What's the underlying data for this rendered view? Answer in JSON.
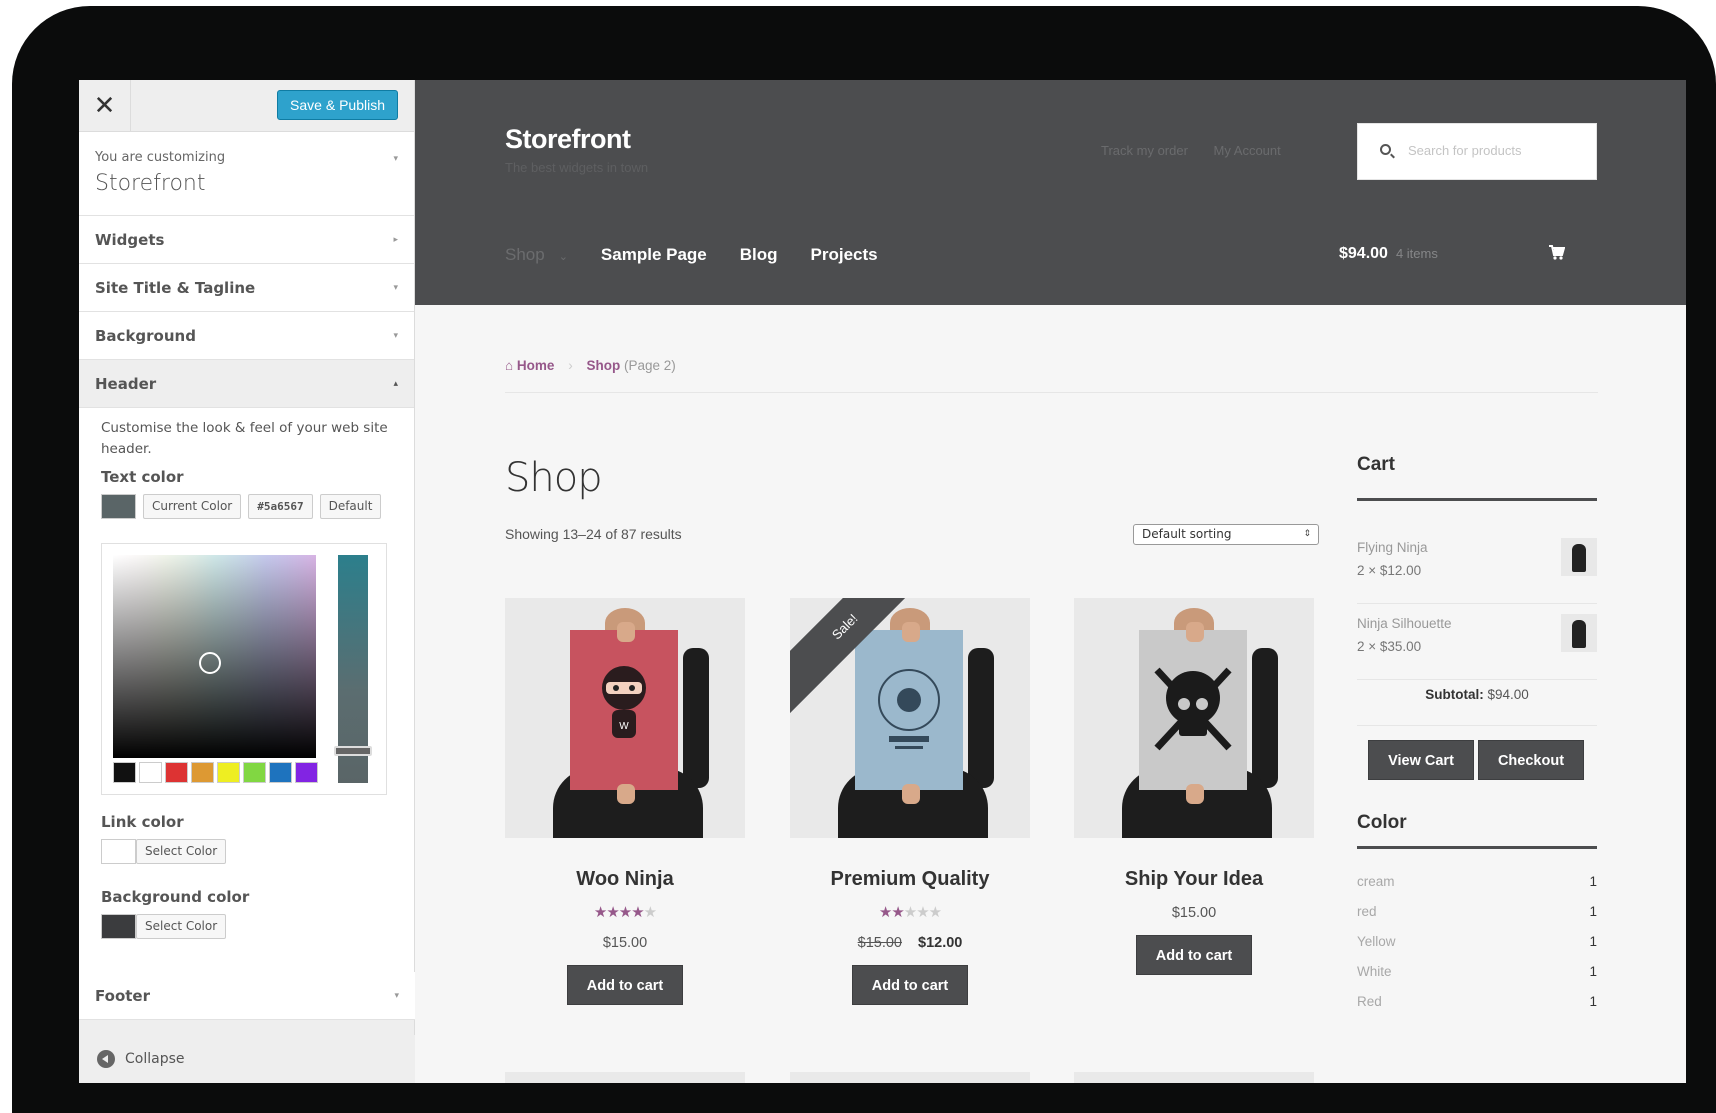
{
  "customizer": {
    "close_glyph": "✕",
    "save_label": "Save & Publish",
    "info_small": "You are customizing",
    "info_big": "Storefront",
    "sections": [
      {
        "label": "Widgets",
        "caret": "▸"
      },
      {
        "label": "Site Title & Tagline",
        "caret": "▾"
      },
      {
        "label": "Background",
        "caret": "▾"
      },
      {
        "label": "Header",
        "caret": "▴"
      }
    ],
    "header_panel": {
      "description": "Customise the look & feel of your web site header.",
      "text_color": {
        "label": "Text color",
        "current_label": "Current Color",
        "hex_value": "#5a6567",
        "default_label": "Default",
        "swatch": "#5a6567"
      },
      "palette": [
        "#111111",
        "#ffffff",
        "#dd3333",
        "#dd9933",
        "#eeee22",
        "#81d742",
        "#1e73be",
        "#8224e3"
      ],
      "link_color": {
        "label": "Link color",
        "button": "Select Color",
        "swatch": "#ffffff"
      },
      "background_color": {
        "label": "Background color",
        "button": "Select Color",
        "swatch": "#3b3c3e"
      }
    },
    "footer": {
      "label": "Footer",
      "caret": "▾"
    },
    "collapse_label": "Collapse"
  },
  "site": {
    "logo": "Storefront",
    "tagline": "The best widgets in town",
    "top_links": [
      "Track my order",
      "My Account"
    ],
    "search_placeholder": "Search for products",
    "nav": {
      "shop": "Shop",
      "shop_chevron": "⌄",
      "items": [
        "Sample Page",
        "Blog",
        "Projects"
      ]
    },
    "minicart": {
      "total": "$94.00",
      "count": "4 items"
    },
    "breadcrumb": {
      "home": "Home",
      "separator": "›",
      "shop": "Shop",
      "page": "(Page 2)"
    },
    "page_title": "Shop",
    "results_text": "Showing 13–24 of 87 results",
    "sorting": {
      "selected": "Default sorting",
      "arrow": "⇕"
    },
    "products": [
      {
        "name": "Woo Ninja",
        "rating": 4,
        "rating_stars": "★★★★",
        "rating_empty": "★",
        "price": "$15.00",
        "button": "Add to cart",
        "poster_color": "#c7535f"
      },
      {
        "name": "Premium Quality",
        "rating": 2,
        "rating_stars": "★★",
        "rating_empty": "★★★",
        "price_old": "$15.00",
        "price_new": "$12.00",
        "sale_badge": "Sale!",
        "button": "Add to cart",
        "poster_color": "#9bb8cc"
      },
      {
        "name": "Ship Your Idea",
        "price": "$15.00",
        "button": "Add to cart",
        "poster_color": "#c9c9c9"
      }
    ],
    "cart_widget": {
      "title": "Cart",
      "items": [
        {
          "name": "Flying Ninja",
          "qty": "2 × $12.00"
        },
        {
          "name": "Ninja Silhouette",
          "qty": "2 × $35.00"
        }
      ],
      "subtotal_label": "Subtotal:",
      "subtotal_value": "$94.00",
      "view_cart": "View Cart",
      "checkout": "Checkout"
    },
    "color_widget": {
      "title": "Color",
      "rows": [
        {
          "name": "cream",
          "count": "1"
        },
        {
          "name": "red",
          "count": "1"
        },
        {
          "name": "Yellow",
          "count": "1"
        },
        {
          "name": "White",
          "count": "1"
        },
        {
          "name": "Red",
          "count": "1"
        }
      ]
    },
    "accent_color": "#96588a",
    "header_bg": "#4c4d4f"
  }
}
